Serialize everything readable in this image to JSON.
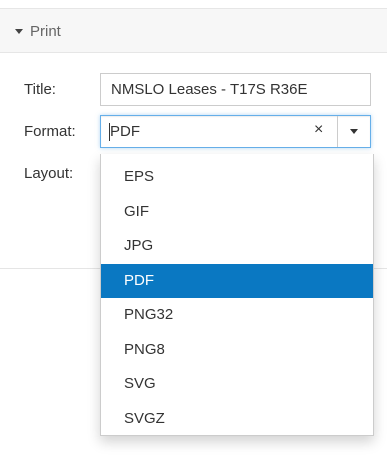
{
  "header": {
    "title": "Print",
    "icon": "caret-down-icon"
  },
  "form": {
    "title_label": "Title:",
    "title_value": "NMSLO Leases - T17S R36E",
    "format_label": "Format:",
    "format_value": "PDF",
    "clear_symbol": "×",
    "layout_label": "Layout:"
  },
  "dropdown": {
    "options": [
      "EPS",
      "GIF",
      "JPG",
      "PDF",
      "PNG32",
      "PNG8",
      "SVG",
      "SVGZ"
    ],
    "selected": "PDF",
    "selected_color": "#0a78c2"
  }
}
